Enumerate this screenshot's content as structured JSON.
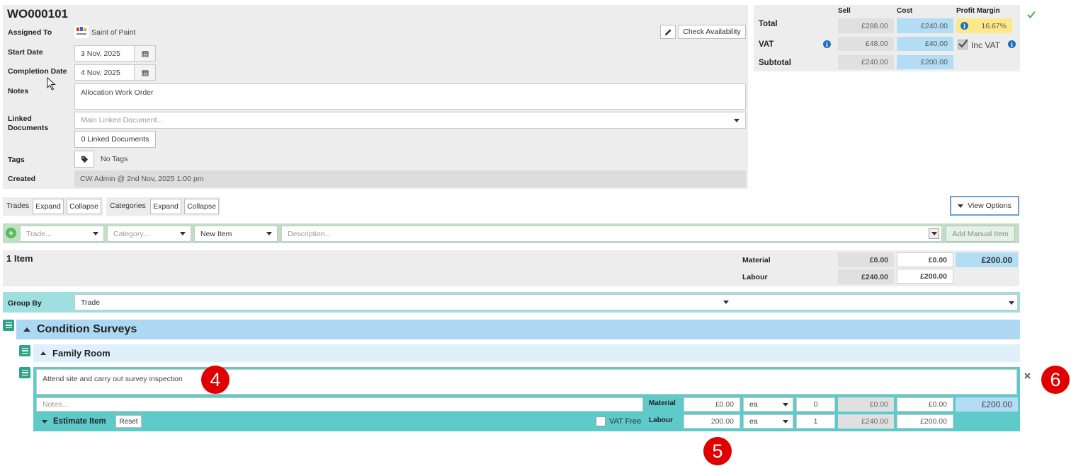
{
  "header": {
    "title": "WO000101",
    "assigned_to_label": "Assigned To",
    "assigned_to_value": "Saint of Paint",
    "start_date_label": "Start Date",
    "start_date_value": "3 Nov, 2025",
    "completion_date_label": "Completion Date",
    "completion_date_value": "4 Nov, 2025",
    "notes_label": "Notes",
    "notes_value": "Allocation Work Order",
    "linked_documents_label": "Linked Documents",
    "linked_document_placeholder": "Main Linked Document...",
    "linked_documents_count": "0 Linked Documents",
    "tags_label": "Tags",
    "tags_value": "No Tags",
    "created_label": "Created",
    "created_value": "CW Admin @ 2nd Nov, 2025 1:00 pm",
    "check_availability_label": "Check Availability"
  },
  "totals": {
    "sell_header": "Sell",
    "cost_header": "Cost",
    "margin_header": "Profit Margin",
    "total_label": "Total",
    "total_sell": "£288.00",
    "total_cost": "£240.00",
    "margin_value": "16.67%",
    "vat_label": "VAT",
    "vat_sell": "£48.00",
    "vat_cost": "£40.00",
    "inc_vat_label": "Inc VAT",
    "subtotal_label": "Subtotal",
    "subtotal_sell": "£240.00",
    "subtotal_cost": "£200.00"
  },
  "toolbar": {
    "trades_label": "Trades",
    "trades_expand": "Expand",
    "trades_collapse": "Collapse",
    "categories_label": "Categories",
    "categories_expand": "Expand",
    "categories_collapse": "Collapse",
    "view_options": "View Options"
  },
  "add_item_row": {
    "trade_placeholder": "Trade...",
    "category_placeholder": "Category...",
    "item_type": "New Item",
    "description_placeholder": "Description...",
    "add_manual_item": "Add Manual Item"
  },
  "summary": {
    "item_count": "1 Item",
    "material_label": "Material",
    "material_sell": "£0.00",
    "material_cost": "£0.00",
    "total_cost": "£200.00",
    "labour_label": "Labour",
    "labour_sell": "£240.00",
    "labour_cost": "£200.00"
  },
  "group_by": {
    "label": "Group By",
    "value": "Trade"
  },
  "groups": {
    "trade_title": "Condition Surveys",
    "category_title": "Family Room"
  },
  "line_item": {
    "description": "Attend site and carry out survey inspection",
    "notes_placeholder": "Notes...",
    "material_label": "Material",
    "material_rate": "£0.00",
    "material_unit": "ea",
    "material_qty": "0",
    "material_sell": "£0.00",
    "material_cost": "£0.00",
    "line_total": "£200.00",
    "estimate_label": "Estimate Item",
    "reset_label": "Reset",
    "vat_free_label": "VAT Free",
    "labour_label": "Labour",
    "labour_rate": "200.00",
    "labour_unit": "ea",
    "labour_qty": "1",
    "labour_sell": "£240.00",
    "labour_cost": "£200.00"
  },
  "callouts": {
    "four": "4",
    "five": "5",
    "six": "6"
  },
  "icons": {
    "calendar": "calendar-icon",
    "pencil": "pencil-icon",
    "tag": "tag-icon",
    "info": "info-icon",
    "check": "check-icon",
    "plus": "plus-circle-icon",
    "menu": "menu-icon",
    "close": "close-icon"
  },
  "colors": {
    "accent_teal": "#5fcaca",
    "cost_blue": "#b3ddf5",
    "margin_yellow": "#fde98a",
    "callout_red": "#e00000",
    "menu_green": "#2aa588"
  }
}
